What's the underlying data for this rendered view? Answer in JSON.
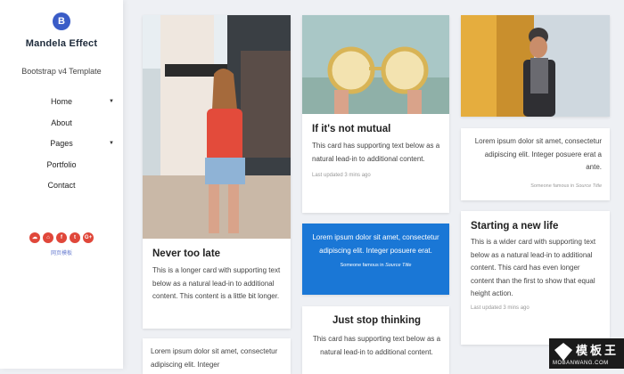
{
  "sidebar": {
    "logo_letter": "B",
    "brand": "Mandela Effect",
    "tagline": "Bootstrap v4 Template",
    "nav": [
      {
        "label": "Home",
        "has_caret": true
      },
      {
        "label": "About",
        "has_caret": false
      },
      {
        "label": "Pages",
        "has_caret": true
      },
      {
        "label": "Portfolio",
        "has_caret": false
      },
      {
        "label": "Contact",
        "has_caret": false
      }
    ],
    "socials": [
      "soundcloud-icon",
      "home-icon",
      "facebook-icon",
      "twitter-icon",
      "google-plus-icon"
    ],
    "web_link": "网页模板"
  },
  "cards": {
    "never_too_late": {
      "title": "Never too late",
      "text": "This is a longer card with supporting text below as a natural lead-in to additional content. This content is a little bit longer."
    },
    "quote_bottom_left": {
      "text": "Lorem ipsum dolor sit amet, consectetur adipiscing elit. Integer"
    },
    "not_mutual": {
      "title": "If it's not mutual",
      "text": "This card has supporting text below as a natural lead-in to additional content.",
      "meta": "Last updated 3 mins ago"
    },
    "blue_quote": {
      "text": "Lorem ipsum dolor sit amet, consectetur adipiscing elit. Integer posuere erat.",
      "footer_prefix": "Someone famous in",
      "footer_source": "Source Title"
    },
    "just_stop": {
      "title": "Just stop thinking",
      "text": "This card has supporting text below as a natural lead-in to additional content."
    },
    "quote_right": {
      "text": "Lorem ipsum dolor sit amet, consectetur adipiscing elit. Integer posuere erat a ante.",
      "footer_prefix": "Someone famous in",
      "footer_source": "Source Title"
    },
    "new_life": {
      "title": "Starting a new life",
      "text": "This is a wider card with supporting text below as a natural lead-in to additional content. This card has even longer content than the first to show that equal height action.",
      "meta": "Last updated 3 mins ago"
    }
  },
  "watermark": {
    "top": "模板王",
    "bottom": "MOBANWANG.COM"
  },
  "colors": {
    "accent_blue": "#1a77d6",
    "social_red": "#e0473a",
    "logo_blue": "#3a5cc7"
  }
}
